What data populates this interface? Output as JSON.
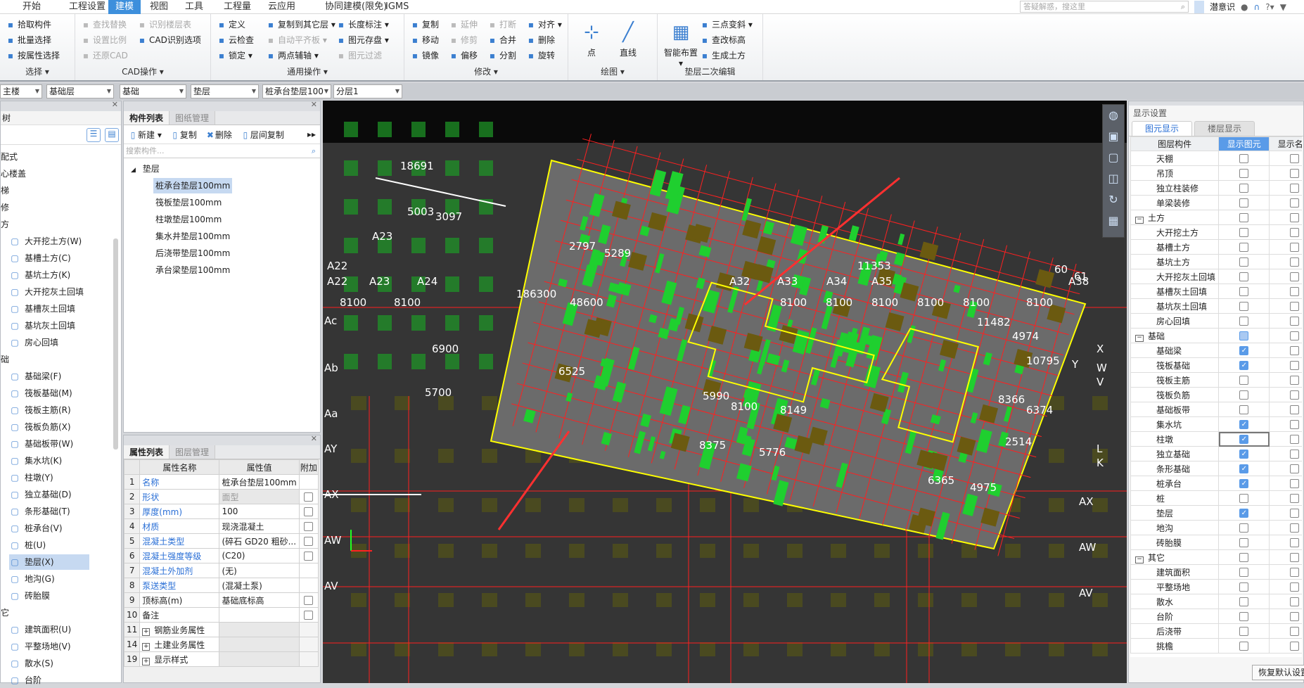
{
  "menu": {
    "items": [
      "开始",
      "工程设置",
      "建模",
      "视图",
      "工具",
      "工程量",
      "云应用",
      "协同建模(限免)",
      "IGMS"
    ],
    "active": 2,
    "search_placeholder": "答疑解惑，搜这里",
    "user": "潜意识"
  },
  "ribbon": {
    "groups": [
      {
        "label": "选择 ▾",
        "cols": [
          [
            {
              "t": "拾取构件",
              "i": "pick-icon"
            },
            {
              "t": "批量选择",
              "i": "batch-select-icon"
            },
            {
              "t": "按属性选择",
              "i": "select-by-attr-icon"
            }
          ]
        ]
      },
      {
        "label": "CAD操作 ▾",
        "cols": [
          [
            {
              "t": "查找替换",
              "d": true,
              "i": "find-replace-icon"
            },
            {
              "t": "设置比例",
              "d": true,
              "i": "scale-icon"
            },
            {
              "t": "还原CAD",
              "d": true,
              "i": "restore-cad-icon"
            }
          ],
          [
            {
              "t": "识别楼层表",
              "d": true,
              "i": "floor-table-icon"
            },
            {
              "t": "CAD识别选项",
              "i": "cad-options-icon"
            }
          ]
        ]
      },
      {
        "label": "通用操作 ▾",
        "cols": [
          [
            {
              "t": "定义",
              "i": "define-icon"
            },
            {
              "t": "云检查",
              "i": "cloud-check-icon"
            },
            {
              "t": "锁定 ▾",
              "i": "lock-icon"
            }
          ],
          [
            {
              "t": "复制到其它层 ▾",
              "i": "copy-floor-icon"
            },
            {
              "t": "自动平齐板 ▾",
              "d": true,
              "i": "align-slab-icon"
            },
            {
              "t": "两点辅轴 ▾",
              "i": "aux-axis-icon"
            }
          ],
          [
            {
              "t": "长度标注 ▾",
              "i": "dimension-icon"
            },
            {
              "t": "图元存盘 ▾",
              "i": "save-element-icon"
            },
            {
              "t": "图元过滤",
              "d": true,
              "i": "filter-icon"
            }
          ]
        ]
      },
      {
        "label": "修改 ▾",
        "cols": [
          [
            {
              "t": "复制",
              "i": "copy-icon"
            },
            {
              "t": "移动",
              "i": "move-icon"
            },
            {
              "t": "镜像",
              "i": "mirror-icon"
            }
          ],
          [
            {
              "t": "延伸",
              "d": true,
              "i": "extend-icon"
            },
            {
              "t": "修剪",
              "d": true,
              "i": "trim-icon"
            },
            {
              "t": "偏移",
              "i": "offset-icon"
            }
          ],
          [
            {
              "t": "打断",
              "d": true,
              "i": "break-icon"
            },
            {
              "t": "合并",
              "i": "merge-icon"
            },
            {
              "t": "分割",
              "i": "split-icon"
            }
          ],
          [
            {
              "t": "对齐 ▾",
              "i": "align-icon"
            },
            {
              "t": "删除",
              "i": "delete-icon"
            },
            {
              "t": "旋转",
              "i": "rotate-icon"
            }
          ]
        ]
      },
      {
        "label": "绘图 ▾",
        "big": [
          {
            "t": "点",
            "i": "point-icon"
          },
          {
            "t": "直线",
            "i": "line-icon"
          }
        ]
      },
      {
        "label": "垫层二次编辑",
        "big": [
          {
            "t": "智能布置 ▾",
            "i": "smart-layout-icon"
          }
        ],
        "cols": [
          [
            {
              "t": "三点变斜 ▾",
              "i": "three-point-slope-icon"
            },
            {
              "t": "查改标高",
              "i": "elevation-icon"
            },
            {
              "t": "生成土方",
              "i": "generate-earthwork-icon"
            }
          ]
        ]
      }
    ]
  },
  "combos": [
    "主楼",
    "基础层",
    "基础",
    "垫层",
    "桩承台垫层100",
    "分层1"
  ],
  "nav": {
    "title": "树",
    "items": [
      {
        "t": "配式",
        "lvl": 0
      },
      {
        "t": "心楼盖",
        "lvl": 0
      },
      {
        "t": "梯",
        "lvl": 0
      },
      {
        "t": "修",
        "lvl": 0
      },
      {
        "t": "方",
        "lvl": 0
      },
      {
        "t": "大开挖土方(W)",
        "lvl": 1
      },
      {
        "t": "基槽土方(C)",
        "lvl": 1
      },
      {
        "t": "基坑土方(K)",
        "lvl": 1
      },
      {
        "t": "大开挖灰土回填",
        "lvl": 1
      },
      {
        "t": "基槽灰土回填",
        "lvl": 1
      },
      {
        "t": "基坑灰土回填",
        "lvl": 1
      },
      {
        "t": "房心回填",
        "lvl": 1
      },
      {
        "t": "础",
        "lvl": 0
      },
      {
        "t": "基础梁(F)",
        "lvl": 1
      },
      {
        "t": "筏板基础(M)",
        "lvl": 1
      },
      {
        "t": "筏板主筋(R)",
        "lvl": 1
      },
      {
        "t": "筏板负筋(X)",
        "lvl": 1
      },
      {
        "t": "基础板带(W)",
        "lvl": 1
      },
      {
        "t": "集水坑(K)",
        "lvl": 1
      },
      {
        "t": "柱墩(Y)",
        "lvl": 1
      },
      {
        "t": "独立基础(D)",
        "lvl": 1
      },
      {
        "t": "条形基础(T)",
        "lvl": 1
      },
      {
        "t": "桩承台(V)",
        "lvl": 1
      },
      {
        "t": "桩(U)",
        "lvl": 1
      },
      {
        "t": "垫层(X)",
        "lvl": 1,
        "sel": true
      },
      {
        "t": "地沟(G)",
        "lvl": 1
      },
      {
        "t": "砖胎膜",
        "lvl": 1
      },
      {
        "t": "它",
        "lvl": 0
      },
      {
        "t": "建筑面积(U)",
        "lvl": 1
      },
      {
        "t": "平整场地(V)",
        "lvl": 1
      },
      {
        "t": "散水(S)",
        "lvl": 1
      },
      {
        "t": "台阶",
        "lvl": 1
      }
    ]
  },
  "components": {
    "tabs": [
      "构件列表",
      "图纸管理"
    ],
    "toolbar": [
      "新建 ▾",
      "复制",
      "删除",
      "层间复制"
    ],
    "search_placeholder": "搜索构件...",
    "group": "垫层",
    "items": [
      "桩承台垫层100mm",
      "筏板垫层100mm",
      "柱墩垫层100mm",
      "集水井垫层100mm",
      "后浇带垫层100mm",
      "承台梁垫层100mm"
    ],
    "selected": 0
  },
  "properties": {
    "tabs": [
      "属性列表",
      "图层管理"
    ],
    "headers": [
      "",
      "属性名称",
      "属性值",
      "附加"
    ],
    "rows": [
      {
        "n": "1",
        "name": "名称",
        "val": "桩承台垫层100mm",
        "blue": true
      },
      {
        "n": "2",
        "name": "形状",
        "val": "面型",
        "blue": true,
        "cb": true,
        "grayval": true
      },
      {
        "n": "3",
        "name": "厚度(mm)",
        "val": "100",
        "blue": true,
        "cb": true
      },
      {
        "n": "4",
        "name": "材质",
        "val": "现浇混凝土",
        "blue": true,
        "cb": true
      },
      {
        "n": "5",
        "name": "混凝土类型",
        "val": "(碎石 GD20 粗砂...",
        "blue": true,
        "cb": true
      },
      {
        "n": "6",
        "name": "混凝土强度等级",
        "val": "(C20)",
        "blue": true,
        "cb": true
      },
      {
        "n": "7",
        "name": "混凝土外加剂",
        "val": "(无)",
        "blue": true
      },
      {
        "n": "8",
        "name": "泵送类型",
        "val": "(混凝土泵)",
        "blue": true
      },
      {
        "n": "9",
        "name": "顶标高(m)",
        "val": "基础底标高",
        "cb": true
      },
      {
        "n": "10",
        "name": "备注",
        "val": "",
        "cb": true
      },
      {
        "n": "11",
        "name": "钢筋业务属性",
        "val": "",
        "exp": true
      },
      {
        "n": "14",
        "name": "土建业务属性",
        "val": "",
        "exp": true
      },
      {
        "n": "19",
        "name": "显示样式",
        "val": "",
        "exp": true
      }
    ]
  },
  "display": {
    "title": "显示设置",
    "tabs": [
      "图元显示",
      "楼层显示"
    ],
    "headers": [
      "图层构件",
      "显示图元",
      "显示名称"
    ],
    "rows": [
      {
        "t": "天棚"
      },
      {
        "t": "吊顶"
      },
      {
        "t": "独立柱装修"
      },
      {
        "t": "单梁装修"
      },
      {
        "t": "土方",
        "g": true
      },
      {
        "t": "大开挖土方"
      },
      {
        "t": "基槽土方"
      },
      {
        "t": "基坑土方"
      },
      {
        "t": "大开挖灰土回填"
      },
      {
        "t": "基槽灰土回填"
      },
      {
        "t": "基坑灰土回填"
      },
      {
        "t": "房心回填"
      },
      {
        "t": "基础",
        "g": true,
        "s": "part"
      },
      {
        "t": "基础梁",
        "s": "on"
      },
      {
        "t": "筏板基础",
        "s": "on"
      },
      {
        "t": "筏板主筋"
      },
      {
        "t": "筏板负筋"
      },
      {
        "t": "基础板带"
      },
      {
        "t": "集水坑",
        "s": "on"
      },
      {
        "t": "柱墩",
        "s": "on",
        "focus": true
      },
      {
        "t": "独立基础",
        "s": "on"
      },
      {
        "t": "条形基础",
        "s": "on"
      },
      {
        "t": "桩承台",
        "s": "on"
      },
      {
        "t": "桩"
      },
      {
        "t": "垫层",
        "s": "on"
      },
      {
        "t": "地沟"
      },
      {
        "t": "砖胎膜"
      },
      {
        "t": "其它",
        "g": true
      },
      {
        "t": "建筑面积"
      },
      {
        "t": "平整场地"
      },
      {
        "t": "散水"
      },
      {
        "t": "台阶"
      },
      {
        "t": "后浇带"
      },
      {
        "t": "挑檐"
      }
    ],
    "restore_button": "恢复默认设置"
  },
  "canvas": {
    "labels": [
      "18691",
      "5003",
      "3097",
      "A23",
      "A22",
      "A22",
      "A23",
      "A24",
      "8100",
      "8100",
      "Ac",
      "6900",
      "Ab",
      "5700",
      "Aa",
      "AY",
      "AX",
      "AW",
      "AV",
      "186300",
      "48600",
      "2797",
      "5289",
      "A32",
      "A33",
      "A34",
      "A35",
      "A38",
      "8100",
      "8100",
      "8100",
      "8100",
      "8100",
      "8100",
      "11353",
      "11482",
      "4974",
      "10795",
      "6374",
      "8366",
      "2514",
      "4975",
      "6365",
      "8375",
      "5776",
      "8149",
      "8100",
      "5990",
      "6525",
      "X",
      "W",
      "V",
      "L",
      "K",
      "Y",
      "AX",
      "AW",
      "AV",
      "60",
      "61"
    ],
    "colors": {
      "background": "#0a0a0a",
      "slab": "#6b6b6b",
      "outline": "#ffff00",
      "grid": "#ff2020",
      "element": "#1fcf2f",
      "pile": "#6b5a10",
      "arrow": "#ff3030"
    }
  }
}
